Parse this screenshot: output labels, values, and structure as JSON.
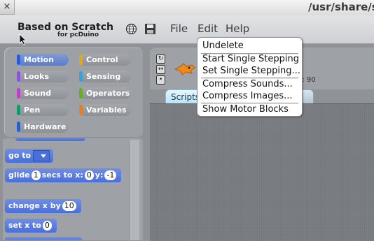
{
  "window": {
    "title": "/usr/share/s",
    "close_glyph": "×"
  },
  "app": {
    "name": "Based on Scratch",
    "subtitle": "for pcDuino"
  },
  "toolbar": {
    "icons": [
      "globe-icon",
      "save-icon"
    ]
  },
  "menubar": {
    "file": "File",
    "edit": "Edit",
    "help": "Help"
  },
  "categories": [
    {
      "label": "Motion",
      "color": "#2c5bd9",
      "selected": true
    },
    {
      "label": "Control",
      "color": "#e1a91a"
    },
    {
      "label": "Looks",
      "color": "#8a55d7"
    },
    {
      "label": "Sensing",
      "color": "#2ca5e2"
    },
    {
      "label": "Sound",
      "color": "#bb42c3"
    },
    {
      "label": "Operators",
      "color": "#5cb712"
    },
    {
      "label": "Pen",
      "color": "#0e9a6c"
    },
    {
      "label": "Variables",
      "color": "#ee7d16"
    },
    {
      "label": "Hardware",
      "color": "#2a5fc9"
    }
  ],
  "blocks": {
    "goto": {
      "label": "go to"
    },
    "glide": {
      "pre": "glide",
      "secs": "1",
      "mid": "secs to x:",
      "x": "0",
      "ylabel": "y:",
      "y": "-1"
    },
    "changex": {
      "label": "change x by",
      "value": "10"
    },
    "setx": {
      "label": "set x to",
      "value": "0"
    }
  },
  "sprite": {
    "direction_label": "n: 90"
  },
  "tabs": {
    "scripts": "Scripts"
  },
  "edit_menu": {
    "undelete": "Undelete",
    "start_single_stepping": "Start Single Stepping",
    "set_single_stepping": "Set Single Stepping...",
    "compress_sounds": "Compress Sounds...",
    "compress_images": "Compress Images...",
    "show_motor_blocks": "Show Motor Blocks"
  }
}
